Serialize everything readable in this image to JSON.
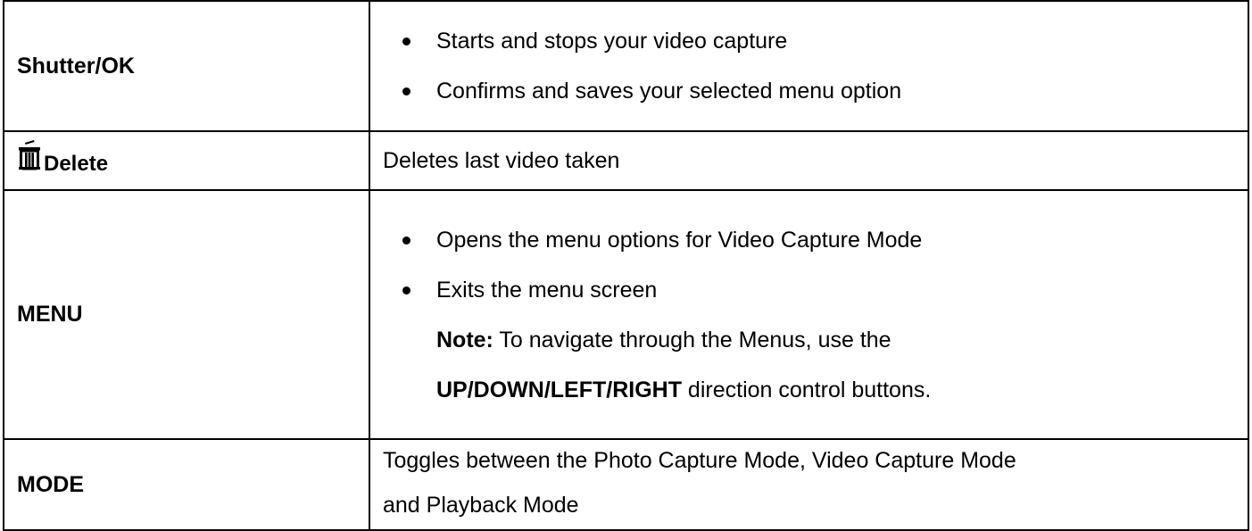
{
  "rows": [
    {
      "button": "Shutter/OK",
      "bullets": [
        "Starts and stops your video capture",
        "Confirms and saves your selected menu option"
      ]
    },
    {
      "button": "Delete",
      "icon": "trash-icon",
      "description": "Deletes last video taken"
    },
    {
      "button": "MENU",
      "bullets": [
        "Opens the menu options for Video Capture Mode",
        "Exits the menu screen"
      ],
      "note_label": "Note:",
      "note_text": " To navigate through the Menus, use the",
      "note_bold": "UP/DOWN/LEFT/RIGHT",
      "note_end": " direction control buttons."
    },
    {
      "button": "MODE",
      "description_line1": "Toggles between the Photo Capture Mode, Video Capture Mode",
      "description_line2": "and Playback Mode"
    }
  ]
}
